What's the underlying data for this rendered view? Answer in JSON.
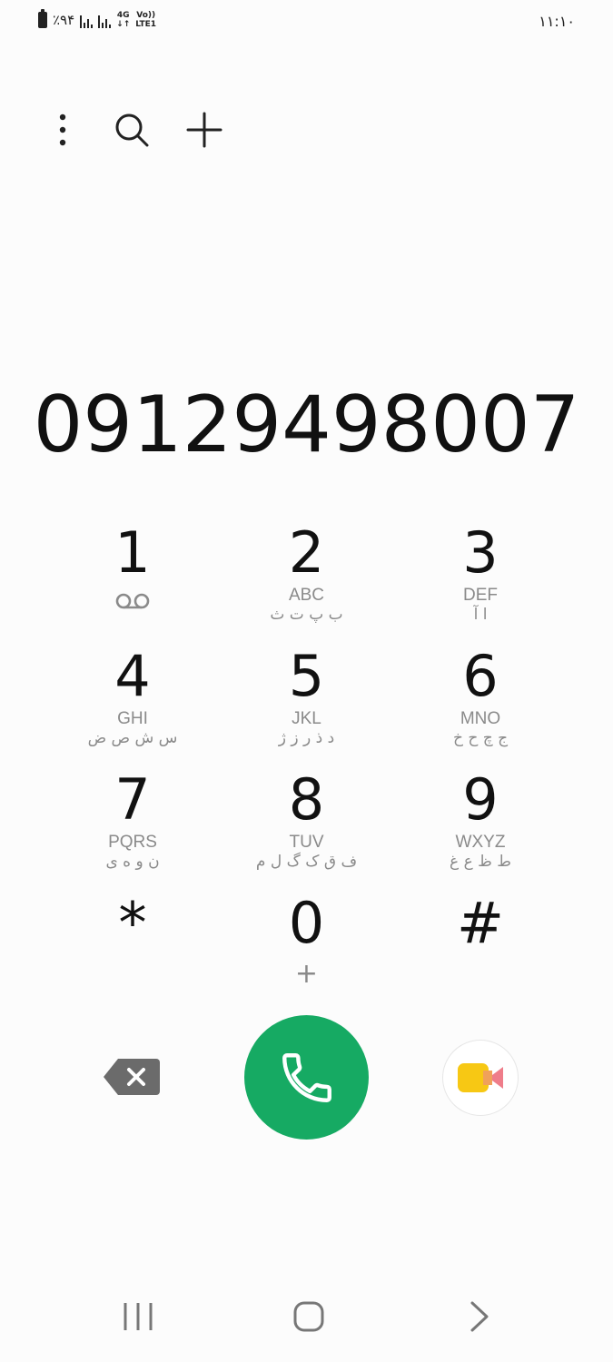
{
  "status_bar": {
    "battery_text": "٪۹۴",
    "network_type": "4G",
    "volte_label": "Vo))",
    "lte_label": "LTE1",
    "time": "۱۱:۱۰",
    "icons": [
      "battery-icon",
      "signal-icon",
      "signal-icon",
      "network-4g-icon"
    ]
  },
  "top_bar": {
    "icons": [
      "more-vert-icon",
      "search-icon",
      "add-icon"
    ]
  },
  "dialer": {
    "number": "09129498007"
  },
  "keypad": {
    "keys": [
      {
        "digit": "1",
        "letters": "",
        "persian": "",
        "sub_icon": "voicemail-icon"
      },
      {
        "digit": "2",
        "letters": "ABC",
        "persian": "ب پ ت ث"
      },
      {
        "digit": "3",
        "letters": "DEF",
        "persian": "ا آ"
      },
      {
        "digit": "4",
        "letters": "GHI",
        "persian": "س ش ص ض"
      },
      {
        "digit": "5",
        "letters": "JKL",
        "persian": "د ذ ر ز ژ"
      },
      {
        "digit": "6",
        "letters": "MNO",
        "persian": "ج چ ح خ"
      },
      {
        "digit": "7",
        "letters": "PQRS",
        "persian": "ن و ه ی"
      },
      {
        "digit": "8",
        "letters": "TUV",
        "persian": "ف ق ک گ ل م"
      },
      {
        "digit": "9",
        "letters": "WXYZ",
        "persian": "ط ظ ع غ"
      },
      {
        "digit": "*",
        "letters": "",
        "persian": ""
      },
      {
        "digit": "0",
        "letters": "",
        "persian": "",
        "plus": "+"
      },
      {
        "digit": "#",
        "letters": "",
        "persian": ""
      }
    ]
  },
  "bottom_actions": {
    "icons": [
      "backspace-icon",
      "phone-icon",
      "video-call-icon"
    ],
    "colors": {
      "call": "#16aa63",
      "video_yellow": "#f7c814",
      "video_pink": "#ef7d8a"
    }
  },
  "nav_bar": {
    "icons": [
      "recents-icon",
      "home-icon",
      "back-icon"
    ]
  }
}
